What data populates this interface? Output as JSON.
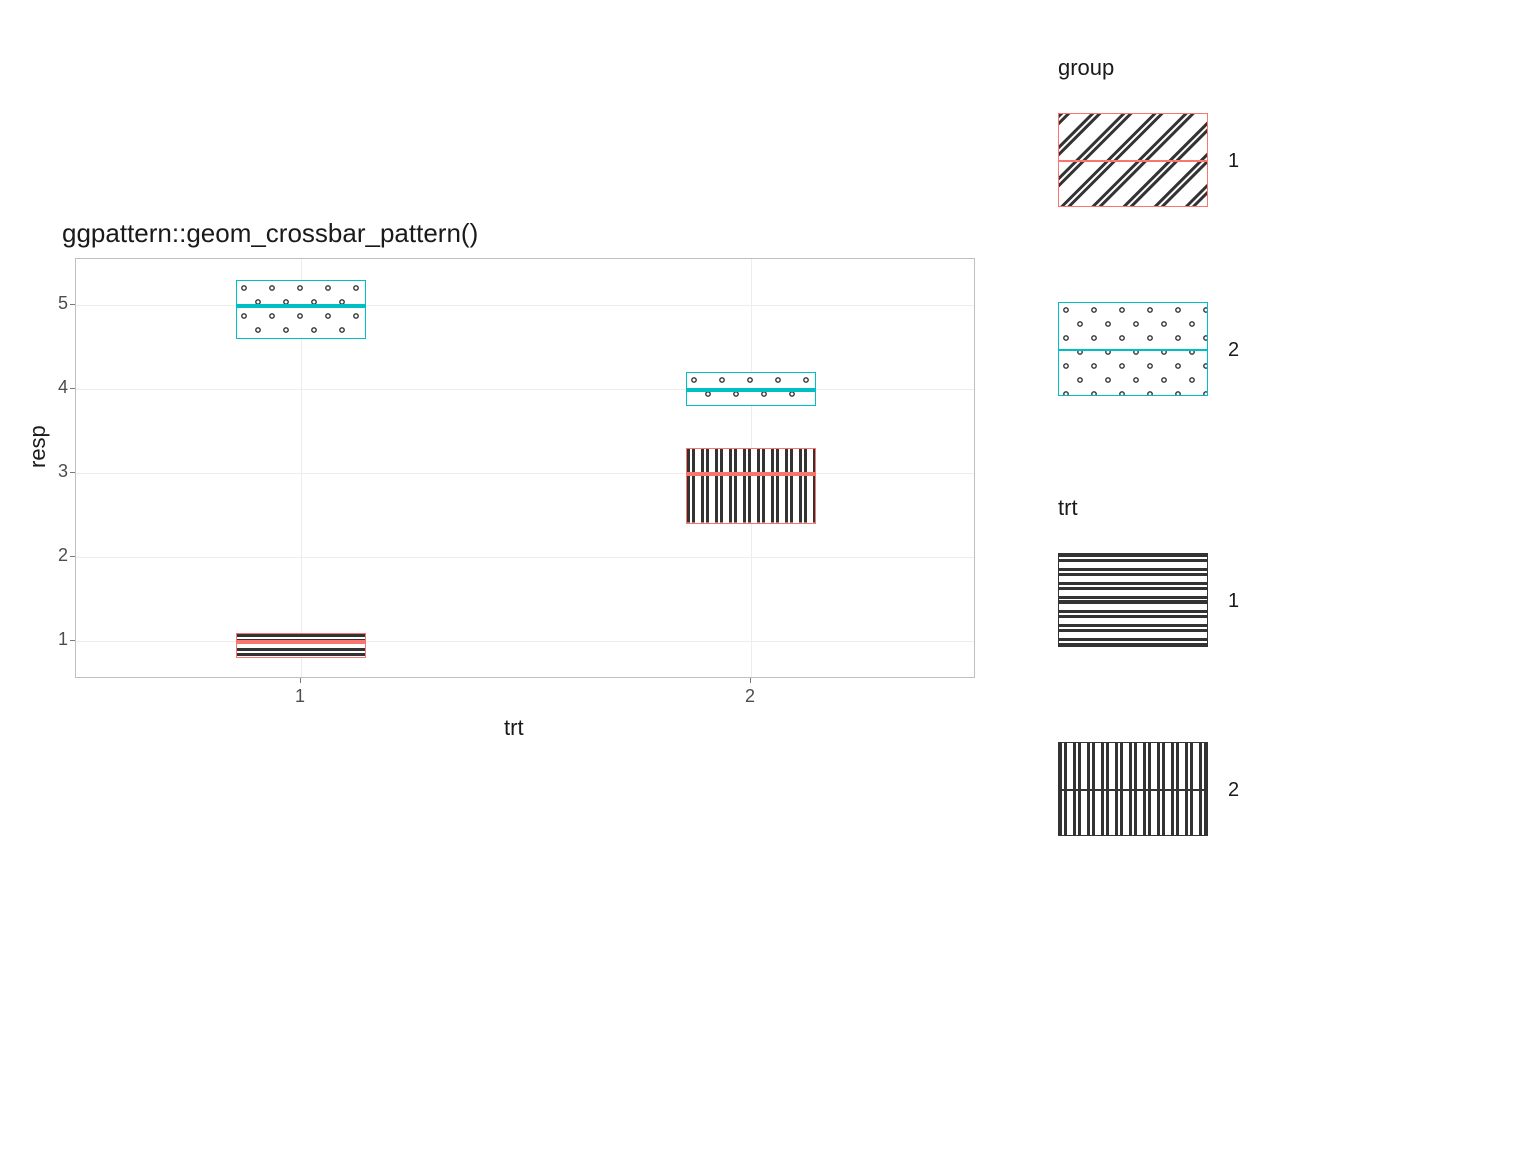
{
  "chart_data": {
    "type": "crossbar",
    "title": "ggpattern::geom_crossbar_pattern()",
    "xlabel": "trt",
    "ylabel": "resp",
    "x_categories": [
      "1",
      "2"
    ],
    "ylim": [
      0.55,
      5.55
    ],
    "y_ticks": [
      1,
      2,
      3,
      4,
      5
    ],
    "x_tick_labels": [
      "1",
      "2"
    ],
    "series": [
      {
        "trt": "1",
        "group": "1",
        "y": 1,
        "ymin": 0.8,
        "ymax": 1.1,
        "color": "#F8766D",
        "pattern": "horizontal-stripe"
      },
      {
        "trt": "1",
        "group": "2",
        "y": 5,
        "ymin": 4.6,
        "ymax": 5.3,
        "color": "#00BFC4",
        "pattern": "dots"
      },
      {
        "trt": "2",
        "group": "1",
        "y": 3,
        "ymin": 2.4,
        "ymax": 3.3,
        "color": "#F8766D",
        "pattern": "vertical-stripe"
      },
      {
        "trt": "2",
        "group": "2",
        "y": 4,
        "ymin": 3.8,
        "ymax": 4.2,
        "color": "#00BFC4",
        "pattern": "dots"
      }
    ],
    "legends": [
      {
        "title": "group",
        "items": [
          {
            "label": "1",
            "color": "#F8766D",
            "pattern": "diagonal-stripe"
          },
          {
            "label": "2",
            "color": "#00BFC4",
            "pattern": "dots"
          }
        ]
      },
      {
        "title": "trt",
        "items": [
          {
            "label": "1",
            "color": "#333333",
            "pattern": "horizontal-stripe"
          },
          {
            "label": "2",
            "color": "#333333",
            "pattern": "vertical-stripe"
          }
        ]
      }
    ]
  },
  "colors": {
    "group1": "#F8766D",
    "group2": "#00BFC4",
    "stroke": "#333333"
  }
}
